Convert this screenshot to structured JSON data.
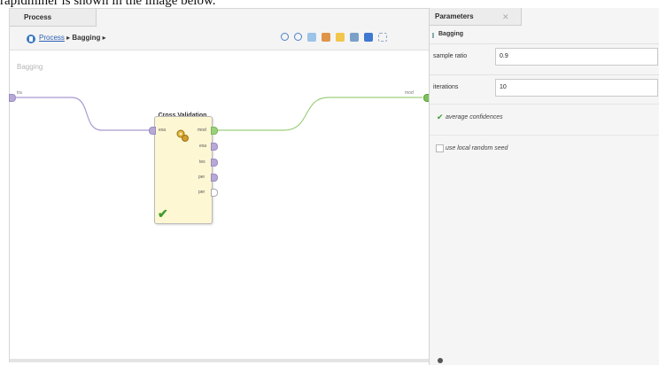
{
  "caption": "rapidminer is shown in the image below.",
  "process_panel": {
    "tab_label": "Process",
    "breadcrumb": {
      "root": "Process",
      "sep1": "▸",
      "current": "Bagging",
      "sep2": "▸"
    },
    "canvas_label": "Bagging",
    "left_port_label": "tra",
    "right_port_label": "mod"
  },
  "operator": {
    "title": "Cross Validation",
    "input_port": "exa",
    "output_ports": [
      "mod",
      "exa",
      "tes",
      "per",
      "per"
    ]
  },
  "parameters_panel": {
    "tab_label": "Parameters",
    "close_glyph": "✕",
    "operator_name": "Bagging",
    "rows": [
      {
        "label": "sample ratio",
        "value": "0.9"
      },
      {
        "label": "iterations",
        "value": "10"
      }
    ],
    "checkboxes": [
      {
        "label": "average confidences",
        "checked": true
      },
      {
        "label": "use local random seed",
        "checked": false
      }
    ]
  },
  "icons": {
    "breadcrumb": "process-icon",
    "toolbar": [
      "zoom-in-icon",
      "zoom-out-icon",
      "copy-icon",
      "paste-icon",
      "note-icon",
      "auto-wire-icon",
      "arrange-icon",
      "fit-icon"
    ],
    "operator": "cross-validation-icon",
    "status": "check-icon"
  },
  "colors": {
    "accent": "#3b78c2",
    "operator_fill": "#fdf7d3",
    "port": "#b7a9d6",
    "ok": "#3a9b2f"
  }
}
